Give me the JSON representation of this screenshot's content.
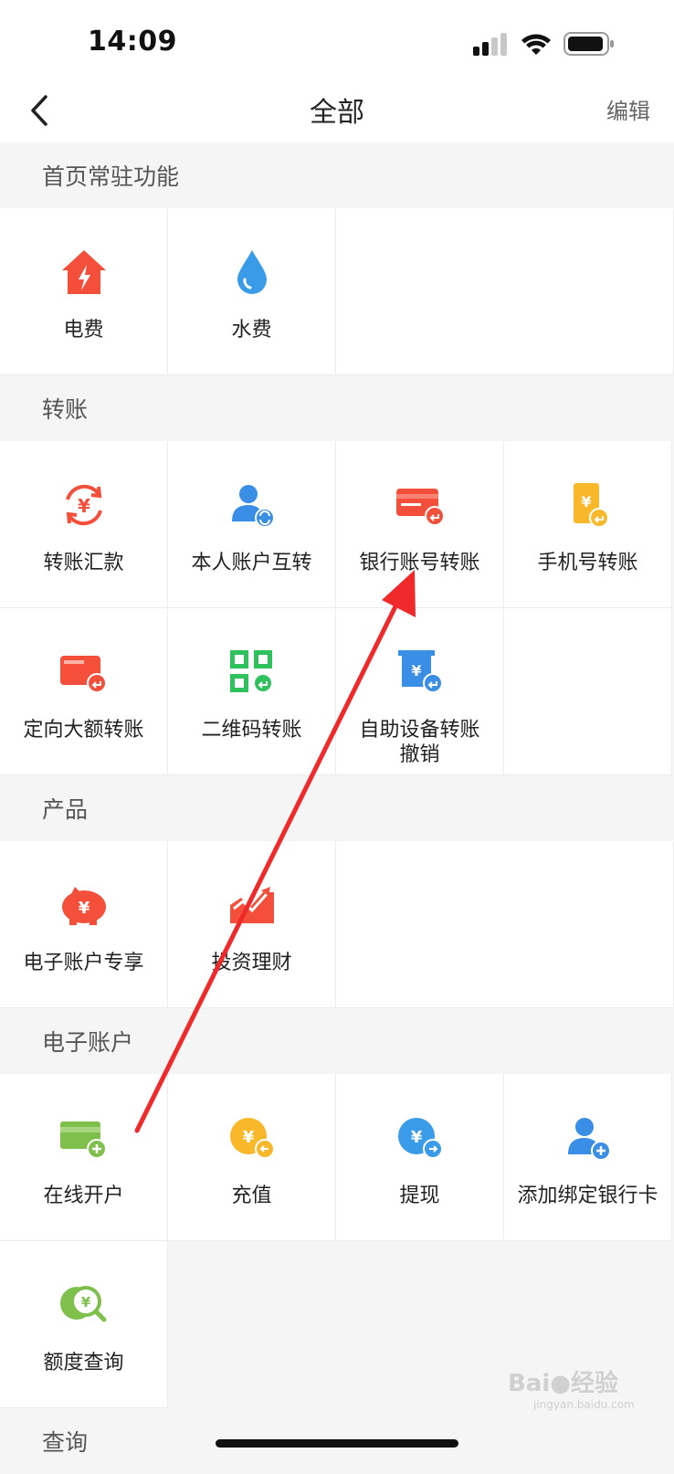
{
  "status_bar": {
    "time": "14:09"
  },
  "nav": {
    "title": "全部",
    "edit_label": "编辑"
  },
  "sections": [
    {
      "title": "首页常驻功能",
      "items": [
        {
          "label": "电费",
          "icon": "house-lightning-icon"
        },
        {
          "label": "水费",
          "icon": "water-drop-icon"
        }
      ]
    },
    {
      "title": "转账",
      "items": [
        {
          "label": "转账汇款",
          "icon": "yuan-cycle-icon"
        },
        {
          "label": "本人账户互转",
          "icon": "user-transfer-icon"
        },
        {
          "label": "银行账号转账",
          "icon": "bank-card-transfer-icon"
        },
        {
          "label": "手机号转账",
          "icon": "phone-transfer-icon"
        },
        {
          "label": "定向大额转账",
          "icon": "large-card-transfer-icon"
        },
        {
          "label": "二维码转账",
          "icon": "qr-code-transfer-icon"
        },
        {
          "label": "自助设备转账",
          "label2": "撤销",
          "icon": "atm-revoke-icon"
        }
      ]
    },
    {
      "title": "产品",
      "items": [
        {
          "label": "电子账户专享",
          "icon": "piggy-bank-icon"
        },
        {
          "label": "投资理财",
          "icon": "investment-chart-icon"
        }
      ]
    },
    {
      "title": "电子账户",
      "items": [
        {
          "label": "在线开户",
          "icon": "card-add-icon"
        },
        {
          "label": "充值",
          "icon": "coin-in-icon"
        },
        {
          "label": "提现",
          "icon": "coin-out-icon"
        },
        {
          "label": "添加绑定银行卡",
          "icon": "user-add-icon"
        },
        {
          "label": "额度查询",
          "icon": "quota-search-icon"
        }
      ]
    },
    {
      "title": "查询",
      "items": []
    }
  ],
  "watermark": {
    "text": "Bai",
    "text2": "经验",
    "sub": "jingyan.baidu.com"
  },
  "colors": {
    "red": "#f44f3b",
    "blue": "#3a8ee6",
    "green": "#2ec15c",
    "yellow": "#f8b82a",
    "light_green": "#7fc04c"
  }
}
